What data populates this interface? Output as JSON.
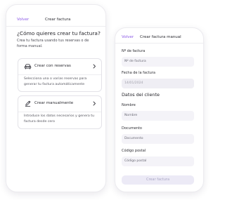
{
  "colors": {
    "accent": "#8c59e6",
    "field_background": "#f4f3f8",
    "button_disabled_background": "#eceaf6",
    "button_disabled_text": "#a9a6c4"
  },
  "choose_screen": {
    "back_label": "Volver",
    "title": "Crear factura",
    "question": "¿Cómo quieres crear tu factura?",
    "intro": "Crea tu factura usando tus reservas o de forma manual.",
    "options": [
      {
        "icon": "car-icon",
        "title": "Crear con reservas",
        "description": "Selecciona una o varias reservas para generar tu factura automáticamente"
      },
      {
        "icon": "pencil-icon",
        "title": "Crear manualmente",
        "description": "Introduce los datos necesarios y genera tu factura desde cero"
      }
    ]
  },
  "manual_screen": {
    "back_label": "Volver",
    "title": "Crear factura manual",
    "fields": {
      "invoice_number": {
        "label": "Nº de factura",
        "placeholder": "Nº de factura"
      },
      "invoice_date": {
        "label": "Fecha de la factura",
        "value": "14/01/2024"
      }
    },
    "client_section_title": "Datos del cliente",
    "client_fields": {
      "name": {
        "label": "Nombre",
        "placeholder": "Nombre"
      },
      "document": {
        "label": "Documento",
        "placeholder": "Documento"
      },
      "postal_code": {
        "label": "Código postal",
        "placeholder": "Código postal"
      }
    },
    "submit_label": "Crear factura"
  }
}
